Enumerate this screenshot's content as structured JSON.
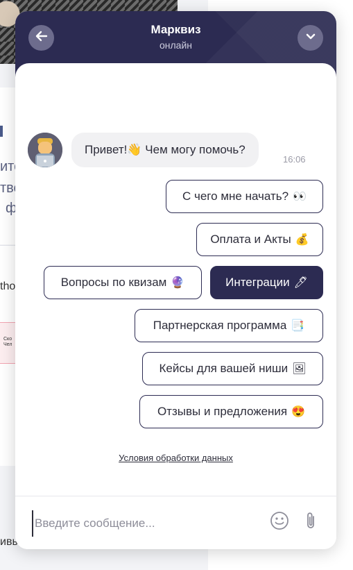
{
  "background_page": {
    "text_fragments": [
      "ито",
      "тве",
      "ф",
      "tho",
      "Ско",
      "Чел",
      "ивы"
    ]
  },
  "chat": {
    "title": "Марквиз",
    "status": "онлайн",
    "back_icon": "arrow-left-icon",
    "collapse_icon": "chevron-down-icon",
    "message": {
      "text": "Привет!👋 Чем могу помочь?",
      "time": "16:06"
    },
    "quick_replies": [
      {
        "label": "С чего мне начать?",
        "emoji": "👀",
        "active": false
      },
      {
        "label": "Оплата и Акты",
        "emoji": "💰",
        "active": false
      },
      {
        "label": "Вопросы по квизам",
        "emoji": "🔮",
        "active": false
      },
      {
        "label": "Интеграции",
        "emoji": "🖊",
        "active": true
      },
      {
        "label": "Партнерская программа",
        "emoji": "📑",
        "active": false
      },
      {
        "label": "Кейсы для вашей ниши",
        "emoji": "🖼",
        "active": false
      },
      {
        "label": "Отзывы и предложения",
        "emoji": "😍",
        "active": false
      }
    ],
    "privacy_link": "Условия обработки данных",
    "input": {
      "placeholder": "Введите сообщение...",
      "value": ""
    },
    "colors": {
      "header": "#2c2b52",
      "active_reply": "#2c2b52"
    }
  }
}
